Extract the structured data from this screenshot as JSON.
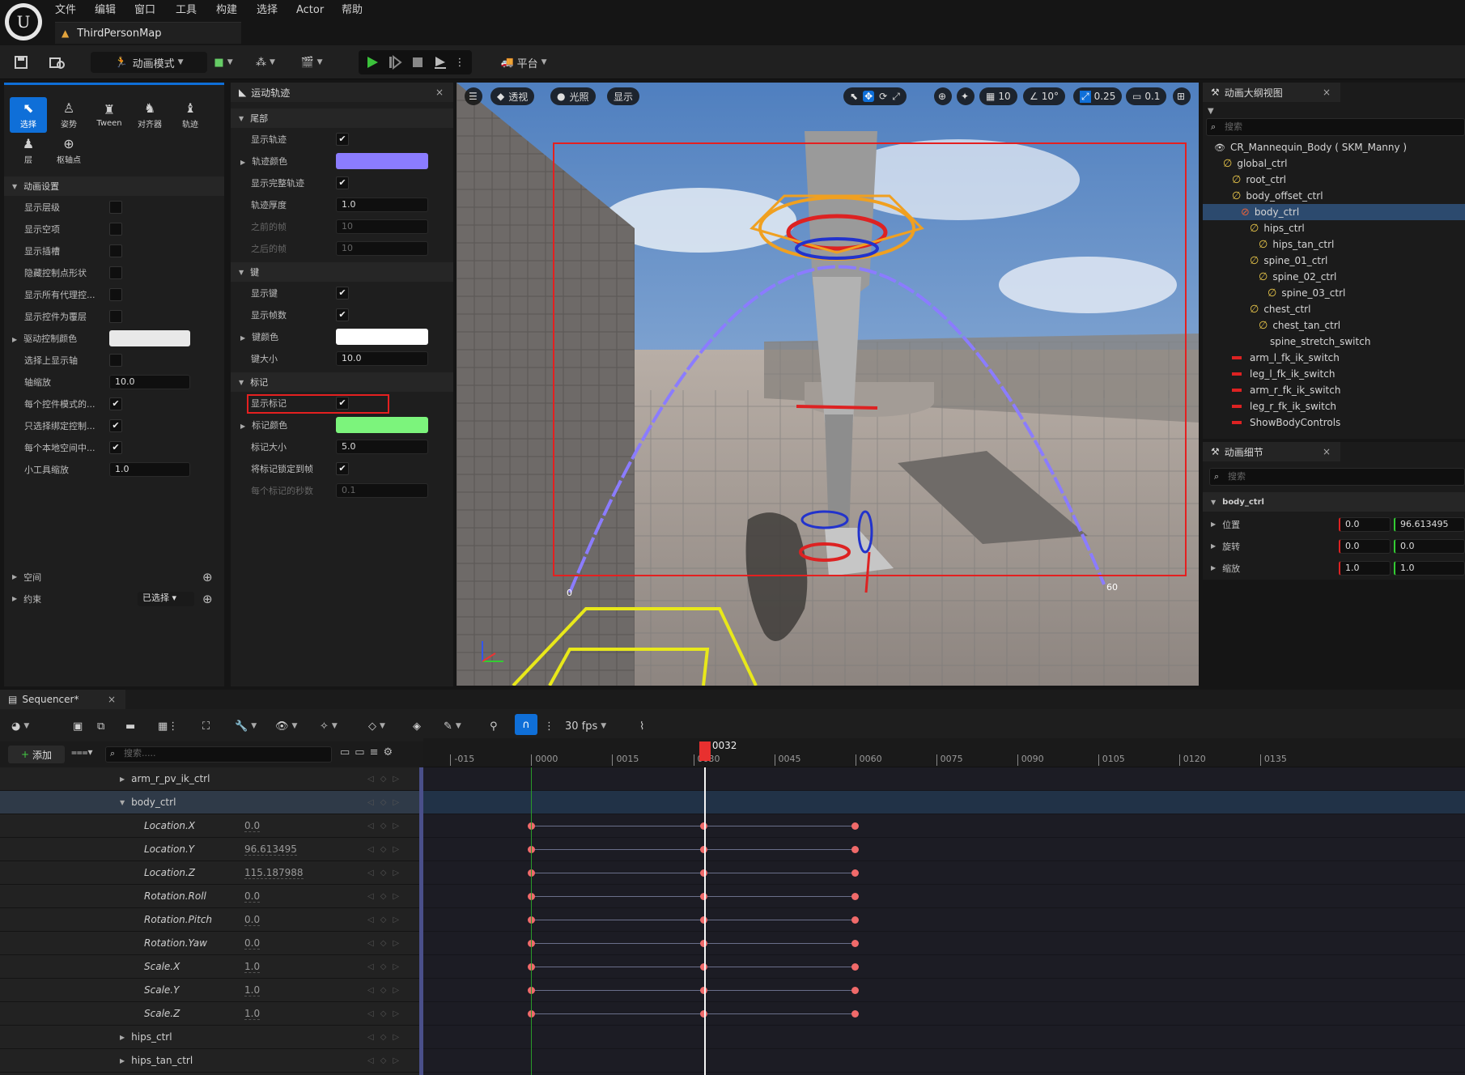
{
  "menu": [
    "文件",
    "编辑",
    "窗口",
    "工具",
    "构建",
    "选择",
    "Actor",
    "帮助"
  ],
  "map_tab": "ThirdPersonMap",
  "toolbar": {
    "mode_label": "动画模式",
    "platform_label": "平台"
  },
  "modes": [
    {
      "label": "选择",
      "icon": "select-icon"
    },
    {
      "label": "姿势",
      "icon": "pose-icon"
    },
    {
      "label": "Tween",
      "icon": "tween-icon"
    },
    {
      "label": "对齐器",
      "icon": "aligner-icon"
    },
    {
      "label": "轨迹",
      "icon": "trail-icon"
    },
    {
      "label": "层",
      "icon": "layer-icon"
    },
    {
      "label": "枢轴点",
      "icon": "pivot-icon"
    }
  ],
  "anim_settings": {
    "title": "动画设置",
    "rows": [
      {
        "label": "显示层级",
        "type": "check",
        "checked": false
      },
      {
        "label": "显示空项",
        "type": "check",
        "checked": false
      },
      {
        "label": "显示插槽",
        "type": "check",
        "checked": false
      },
      {
        "label": "隐藏控制点形状",
        "type": "check",
        "checked": false
      },
      {
        "label": "显示所有代理控...",
        "type": "check",
        "checked": false
      },
      {
        "label": "显示控件为覆层",
        "type": "check",
        "checked": false
      },
      {
        "label": "驱动控制颜色",
        "type": "color",
        "color": "#e8e8e8"
      },
      {
        "label": "选择上显示轴",
        "type": "check",
        "checked": false
      },
      {
        "label": "轴缩放",
        "type": "num",
        "value": "10.0"
      },
      {
        "label": "每个控件模式的...",
        "type": "check",
        "checked": true
      },
      {
        "label": "只选择绑定控制...",
        "type": "check",
        "checked": true
      },
      {
        "label": "每个本地空间中...",
        "type": "check",
        "checked": true
      },
      {
        "label": "小工具缩放",
        "type": "num",
        "value": "1.0"
      }
    ],
    "space_label": "空间",
    "constraint_label": "约束",
    "constraint_value": "已选择"
  },
  "motion_trail": {
    "tab": "运动轨迹",
    "sections": [
      {
        "title": "尾部",
        "rows": [
          {
            "label": "显示轨迹",
            "type": "check",
            "checked": true
          },
          {
            "label": "轨迹颜色",
            "type": "color",
            "color": "#8b7cff"
          },
          {
            "label": "显示完整轨迹",
            "type": "check",
            "checked": true
          },
          {
            "label": "轨迹厚度",
            "type": "num",
            "value": "1.0"
          },
          {
            "label": "之前的帧",
            "type": "num",
            "value": "10",
            "disabled": true
          },
          {
            "label": "之后的帧",
            "type": "num",
            "value": "10",
            "disabled": true
          }
        ]
      },
      {
        "title": "键",
        "rows": [
          {
            "label": "显示键",
            "type": "check",
            "checked": true
          },
          {
            "label": "显示帧数",
            "type": "check",
            "checked": true
          },
          {
            "label": "键颜色",
            "type": "color",
            "color": "#ffffff"
          },
          {
            "label": "键大小",
            "type": "num",
            "value": "10.0"
          }
        ]
      },
      {
        "title": "标记",
        "rows": [
          {
            "label": "显示标记",
            "type": "check",
            "checked": true,
            "highlight": true
          },
          {
            "label": "标记颜色",
            "type": "color",
            "color": "#7cf47c"
          },
          {
            "label": "标记大小",
            "type": "num",
            "value": "5.0"
          },
          {
            "label": "将标记锁定到帧",
            "type": "check",
            "checked": true
          },
          {
            "label": "每个标记的秒数",
            "type": "num",
            "value": "0.1",
            "disabled": true
          }
        ]
      }
    ]
  },
  "viewport": {
    "perspective": "透视",
    "lit": "光照",
    "show": "显示",
    "grid": "10",
    "angle": "10°",
    "scale": "0.25",
    "camera": "0.1",
    "trail_start_label": "0",
    "trail_end_label": "60"
  },
  "outliner": {
    "tab": "动画大纲视图",
    "search": "搜索",
    "items": [
      {
        "label": "CR_Mannequin_Body ( SKM_Manny )",
        "depth": 0,
        "icon": "eye"
      },
      {
        "label": "global_ctrl",
        "depth": 1,
        "icon": "ctrl"
      },
      {
        "label": "root_ctrl",
        "depth": 2,
        "icon": "ctrl"
      },
      {
        "label": "body_offset_ctrl",
        "depth": 2,
        "icon": "ctrl"
      },
      {
        "label": "body_ctrl",
        "depth": 3,
        "icon": "ctrl",
        "selected": true
      },
      {
        "label": "hips_ctrl",
        "depth": 4,
        "icon": "ctrl"
      },
      {
        "label": "hips_tan_ctrl",
        "depth": 5,
        "icon": "ctrl"
      },
      {
        "label": "spine_01_ctrl",
        "depth": 4,
        "icon": "ctrl"
      },
      {
        "label": "spine_02_ctrl",
        "depth": 5,
        "icon": "ctrl"
      },
      {
        "label": "spine_03_ctrl",
        "depth": 6,
        "icon": "ctrl"
      },
      {
        "label": "chest_ctrl",
        "depth": 4,
        "icon": "ctrl"
      },
      {
        "label": "chest_tan_ctrl",
        "depth": 5,
        "icon": "ctrl"
      },
      {
        "label": "spine_stretch_switch",
        "depth": 5,
        "icon": "none"
      },
      {
        "label": "arm_l_fk_ik_switch",
        "depth": 2,
        "icon": "red"
      },
      {
        "label": "leg_l_fk_ik_switch",
        "depth": 2,
        "icon": "red"
      },
      {
        "label": "arm_r_fk_ik_switch",
        "depth": 2,
        "icon": "red"
      },
      {
        "label": "leg_r_fk_ik_switch",
        "depth": 2,
        "icon": "red"
      },
      {
        "label": "ShowBodyControls",
        "depth": 2,
        "icon": "red"
      }
    ]
  },
  "details": {
    "tab": "动画细节",
    "search": "搜索",
    "object": "body_ctrl",
    "rows": [
      {
        "label": "位置",
        "v1": "0.0",
        "v2": "96.613495"
      },
      {
        "label": "旋转",
        "v1": "0.0",
        "v2": "0.0"
      },
      {
        "label": "缩放",
        "v1": "1.0",
        "v2": "1.0"
      }
    ]
  },
  "sequencer": {
    "tab": "Sequencer*",
    "fps": "30 fps",
    "add": "添加",
    "search": "搜索.....",
    "playhead": "0032",
    "ticks": [
      "-015",
      "0000",
      "0015",
      "0030",
      "0045",
      "0060",
      "0075",
      "0090",
      "0105",
      "0120",
      "0135"
    ],
    "tracks": [
      {
        "label": "arm_r_pv_ik_ctrl",
        "type": "group"
      },
      {
        "label": "body_ctrl",
        "type": "group-open",
        "selected": true
      },
      {
        "label": "Location.X",
        "value": "0.0"
      },
      {
        "label": "Location.Y",
        "value": "96.613495"
      },
      {
        "label": "Location.Z",
        "value": "115.187988"
      },
      {
        "label": "Rotation.Roll",
        "value": "0.0"
      },
      {
        "label": "Rotation.Pitch",
        "value": "0.0"
      },
      {
        "label": "Rotation.Yaw",
        "value": "0.0"
      },
      {
        "label": "Scale.X",
        "value": "1.0"
      },
      {
        "label": "Scale.Y",
        "value": "1.0"
      },
      {
        "label": "Scale.Z",
        "value": "1.0"
      },
      {
        "label": "hips_ctrl",
        "type": "group"
      },
      {
        "label": "hips_tan_ctrl",
        "type": "group"
      }
    ],
    "key_frames": [
      0,
      32,
      60
    ]
  },
  "colors": {
    "accent": "#0f6fd8",
    "trail": "#8b7cff",
    "playhead": "#e8302f"
  }
}
